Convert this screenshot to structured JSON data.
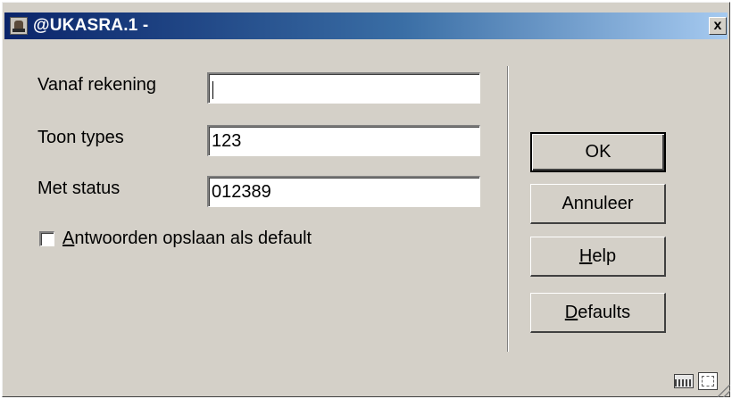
{
  "window": {
    "title": "@UKASRA.1 -",
    "close_label": "x"
  },
  "form": {
    "from_account": {
      "label": "Vanaf rekening",
      "value": ""
    },
    "show_types": {
      "label": "Toon types",
      "value": "123"
    },
    "with_status": {
      "label": "Met status",
      "value": "012389"
    },
    "save_defaults": {
      "label_mnemonic": "A",
      "label_rest": "ntwoorden opslaan als default",
      "checked": false
    }
  },
  "buttons": {
    "ok": "OK",
    "cancel": "Annuleer",
    "help_mnemonic": "H",
    "help_rest": "elp",
    "defaults_mnemonic": "D",
    "defaults_rest": "efaults"
  },
  "statusbar": {
    "icons": [
      "keyboard-icon",
      "resize-icon",
      "size-grip-icon"
    ]
  }
}
